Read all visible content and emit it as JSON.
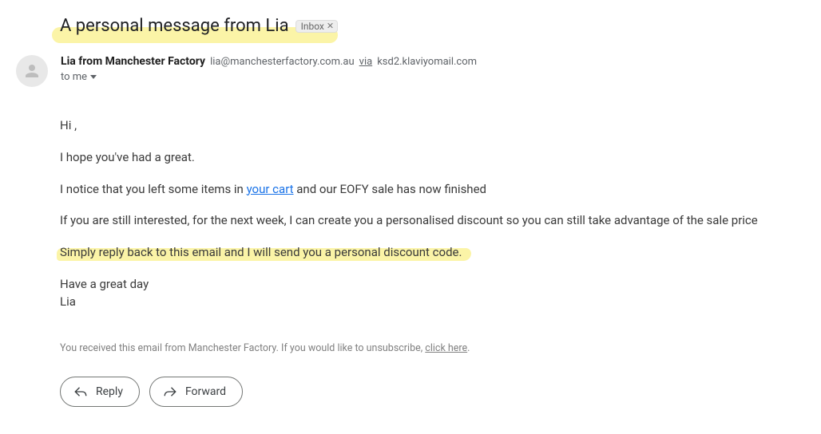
{
  "subject": "A personal message from Lia",
  "inbox_label": "Inbox",
  "sender": {
    "name": "Lia from Manchester Factory",
    "email": "lia@manchesterfactory.com.au",
    "via_word": "via",
    "via_domain": "ksd2.klaviyomail.com"
  },
  "to_line": "to me",
  "body": {
    "greeting": "Hi ,",
    "line1": "I hope you've had a great.",
    "line2_a": "I notice that you left some items in ",
    "line2_link": "your cart",
    "line2_b": " and our EOFY sale has now finished",
    "line3": "If you are still interested, for the next week, I can create you a personalised discount so you can still take advantage of the sale price",
    "line4": "Simply reply back to this email and I will send you a personal discount code.",
    "sig1": "Have a great day",
    "sig2": "Lia"
  },
  "footer": {
    "text": "You received this email from Manchester Factory. If you would like to unsubscribe, ",
    "link": "click here",
    "period": "."
  },
  "actions": {
    "reply": "Reply",
    "forward": "Forward"
  }
}
